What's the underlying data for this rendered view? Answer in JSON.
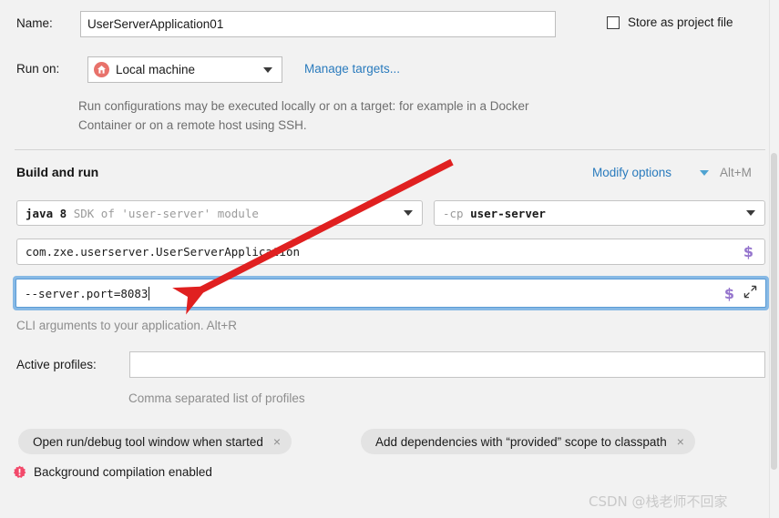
{
  "name_row": {
    "label": "Name:",
    "value": "UserServerApplication01",
    "store_checkbox_label": "Store as project file"
  },
  "run_on": {
    "label": "Run on:",
    "selected": "Local machine",
    "manage_targets_link": "Manage targets...",
    "hint": "Run configurations may be executed locally or on a target: for example in a Docker Container or on a remote host using SSH."
  },
  "build_and_run": {
    "title": "Build and run",
    "modify_options_label": "Modify options",
    "modify_options_shortcut": "Alt+M",
    "sdk": {
      "prefix": "java 8",
      "suffix": "SDK of 'user-server' module"
    },
    "classpath": {
      "prefix": "-cp",
      "value": "user-server"
    },
    "main_class": "com.zxe.userserver.UserServerApplication",
    "cli_arguments": {
      "value": "--server.port=8083",
      "hint": "CLI arguments to your application. Alt+R"
    }
  },
  "active_profiles": {
    "label": "Active profiles:",
    "value": "",
    "placeholder": "",
    "hint": "Comma separated list of profiles"
  },
  "chips": [
    {
      "label": "Open run/debug tool window when started",
      "close": "×"
    },
    {
      "label": "Add dependencies with “provided” scope to classpath",
      "close": "×"
    }
  ],
  "status": {
    "background_compilation": "Background compilation enabled"
  },
  "watermark": "CSDN @栈老师不回家",
  "colors": {
    "accent_link": "#2a7bbd",
    "focus_border": "#5b9bd5",
    "focus_glow": "#87b9e5",
    "macro_purple": "#9575cd",
    "warning_red": "#f2496a",
    "home_icon": "#e8726b",
    "annotation_red": "#e02020",
    "chip_bg": "#e3e3e3",
    "page_bg": "#f2f2f2"
  }
}
